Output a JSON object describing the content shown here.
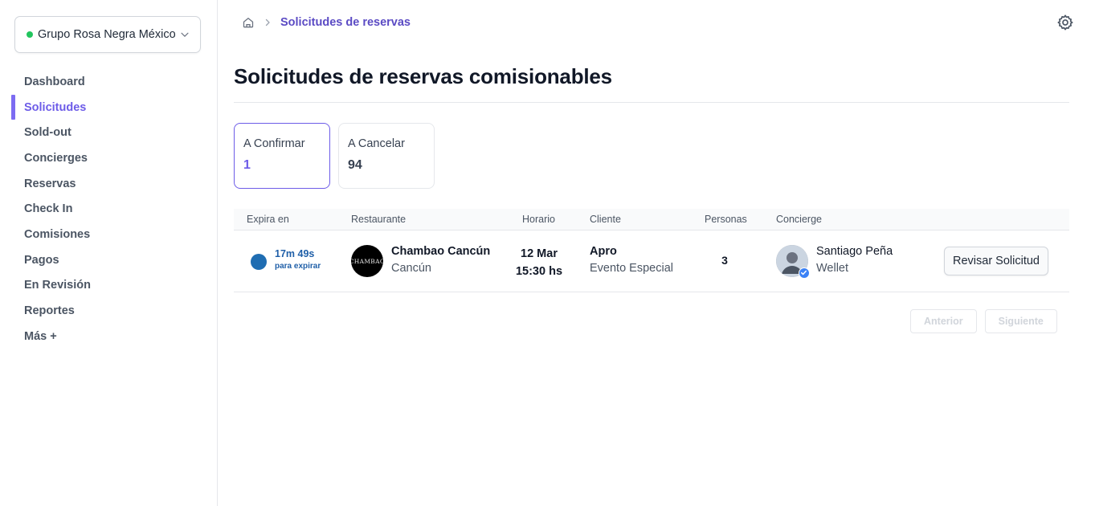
{
  "sidebar": {
    "org": {
      "name": "Grupo Rosa Negra México",
      "status_color": "#22c55e"
    },
    "items": [
      {
        "label": "Dashboard"
      },
      {
        "label": "Solicitudes",
        "active": true
      },
      {
        "label": "Sold-out"
      },
      {
        "label": "Concierges"
      },
      {
        "label": "Reservas"
      },
      {
        "label": "Check In"
      },
      {
        "label": "Comisiones"
      },
      {
        "label": "Pagos"
      },
      {
        "label": "En Revisión"
      },
      {
        "label": "Reportes"
      },
      {
        "label": "Más +"
      }
    ]
  },
  "header": {
    "breadcrumb_current": "Solicitudes de reservas",
    "title": "Solicitudes de reservas comisionables"
  },
  "tabs": [
    {
      "label": "A Confirmar",
      "count": "1",
      "active": true
    },
    {
      "label": "A Cancelar",
      "count": "94"
    }
  ],
  "table": {
    "columns": [
      "Expira en",
      "Restaurante",
      "Horario",
      "Cliente",
      "Personas",
      "Concierge"
    ],
    "rows": [
      {
        "expira": "17m 49s",
        "expira_sub": "para expirar",
        "restaurante": "Chambao Cancún",
        "restaurante_logo": "CHAMBAO",
        "ciudad": "Cancún",
        "fecha": "12 Mar",
        "hora": "15:30 hs",
        "cliente": "Apro",
        "evento": "Evento Especial",
        "personas": "3",
        "concierge": "Santiago Peña",
        "concierge_org": "Wellet",
        "action": "Revisar Solicitud"
      }
    ]
  },
  "pager": {
    "prev": "Anterior",
    "next": "Siguiente"
  },
  "colors": {
    "accent": "#6d5ce8",
    "expire": "#1f6db2"
  }
}
